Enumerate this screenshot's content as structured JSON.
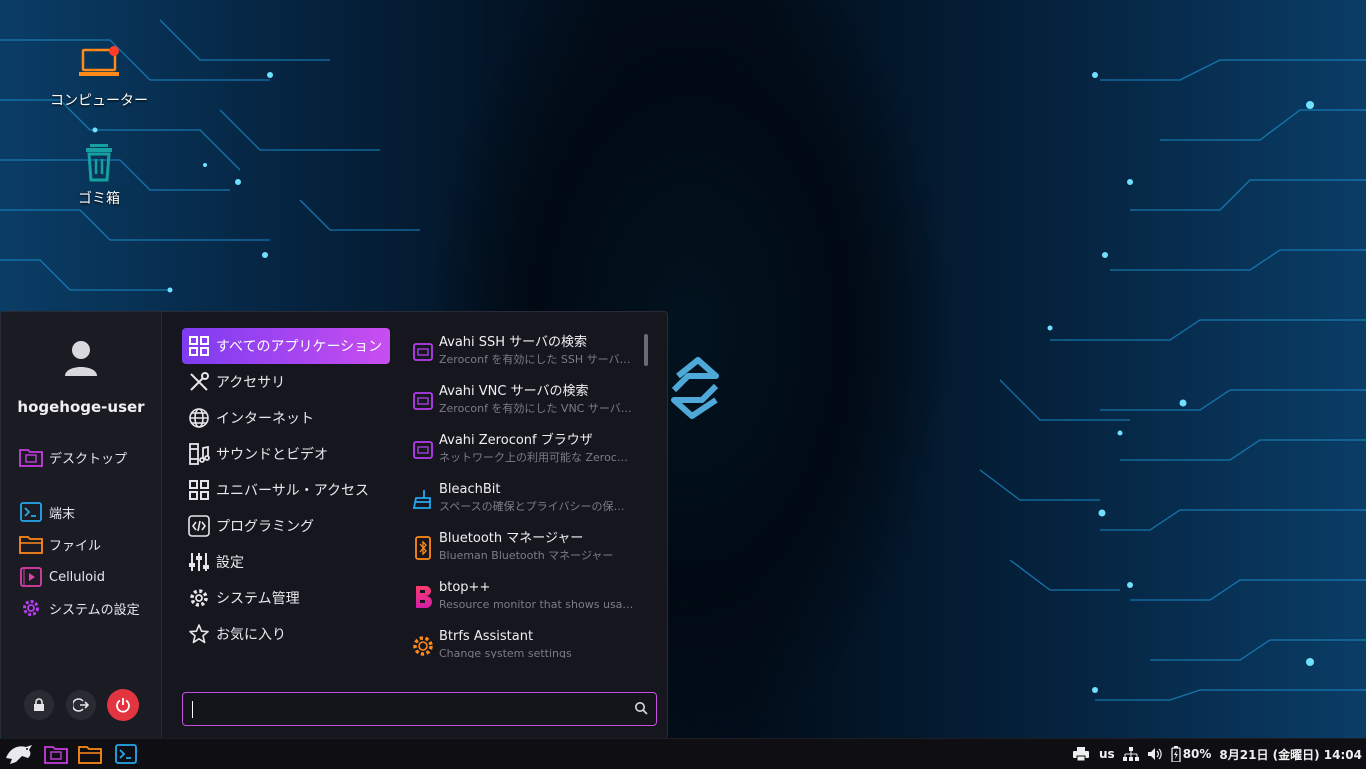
{
  "desktop": {
    "icons": [
      {
        "label": "コンピューター",
        "icon": "laptop-icon"
      },
      {
        "label": "ゴミ箱",
        "icon": "trash-icon"
      }
    ]
  },
  "menu": {
    "username": "hogehoge-user",
    "favorites": [
      {
        "label": "デスクトップ",
        "icon": "folder-desktop-icon"
      },
      {
        "label": "端末",
        "icon": "terminal-icon"
      },
      {
        "label": "ファイル",
        "icon": "folder-icon"
      },
      {
        "label": "Celluloid",
        "icon": "video-player-icon"
      },
      {
        "label": "システムの設定",
        "icon": "gear-icon"
      }
    ],
    "categories": [
      {
        "label": "すべてのアプリケーション",
        "icon": "grid-icon",
        "active": true
      },
      {
        "label": "アクセサリ",
        "icon": "tools-icon"
      },
      {
        "label": "インターネット",
        "icon": "globe-icon"
      },
      {
        "label": "サウンドとビデオ",
        "icon": "media-icon"
      },
      {
        "label": "ユニバーサル・アクセス",
        "icon": "grid-icon"
      },
      {
        "label": "プログラミング",
        "icon": "code-icon"
      },
      {
        "label": "設定",
        "icon": "sliders-icon"
      },
      {
        "label": "システム管理",
        "icon": "gear-icon"
      },
      {
        "label": "お気に入り",
        "icon": "star-icon"
      }
    ],
    "apps": [
      {
        "name": "Avahi SSH サーバの検索",
        "desc": "Zeroconf を有効にした SSH サーバ…"
      },
      {
        "name": "Avahi VNC サーバの検索",
        "desc": "Zeroconf を有効にした VNC サーバ…"
      },
      {
        "name": "Avahi Zeroconf ブラウザ",
        "desc": "ネットワーク上の利用可能な Zeroc…"
      },
      {
        "name": "BleachBit",
        "desc": "スペースの確保とプライバシーの保…"
      },
      {
        "name": "Bluetooth マネージャー",
        "desc": "Blueman Bluetooth マネージャー"
      },
      {
        "name": "btop++",
        "desc": "Resource monitor that shows usa…"
      },
      {
        "name": "Btrfs Assistant",
        "desc": "Change system settings"
      }
    ],
    "search": {
      "value": ""
    },
    "session_buttons": [
      "lock-icon",
      "logout-icon",
      "power-icon"
    ]
  },
  "taskbar": {
    "launchers": [
      "eagle-menu-icon",
      "folder-desktop-icon",
      "folder-icon",
      "terminal-icon"
    ],
    "tray": {
      "keyboard_layout": "us",
      "battery": "80%",
      "clock": "8月21日 (金曜日) 14:04"
    }
  },
  "colors": {
    "accent_start": "#7d3cf0",
    "accent_end": "#c84ef0",
    "power_button": "#e2353f",
    "desktop_dark": "#020d1a",
    "desktop_blue": "#0a3d66"
  }
}
